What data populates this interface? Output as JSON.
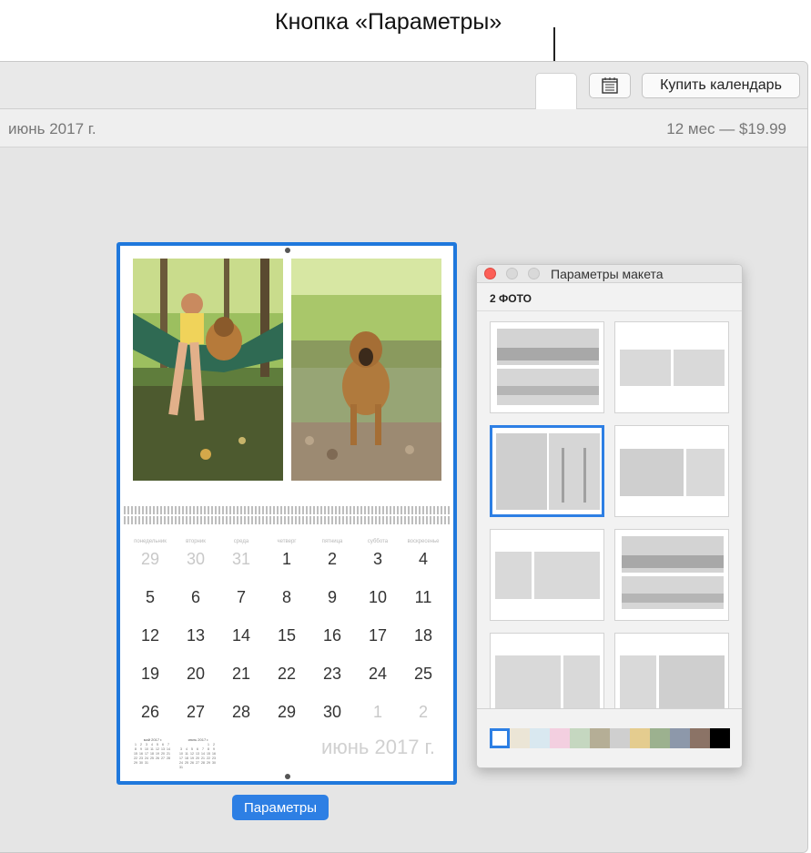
{
  "callout": {
    "label": "Кнопка «Параметры»"
  },
  "toolbar": {
    "layout_icon": "layout-panels-icon",
    "calendar_icon": "calendar-text-icon",
    "buy_label": "Купить календарь"
  },
  "infobar": {
    "month": "июнь 2017 г.",
    "price": "12 мес — $19.99"
  },
  "calendar_page": {
    "weekdays": [
      "понедельник",
      "вторник",
      "среда",
      "четверг",
      "пятница",
      "суббота",
      "воскресенье"
    ],
    "weeks": [
      [
        {
          "d": "29",
          "other": true
        },
        {
          "d": "30",
          "other": true
        },
        {
          "d": "31",
          "other": true
        },
        {
          "d": "1"
        },
        {
          "d": "2"
        },
        {
          "d": "3"
        },
        {
          "d": "4"
        }
      ],
      [
        {
          "d": "5"
        },
        {
          "d": "6"
        },
        {
          "d": "7"
        },
        {
          "d": "8"
        },
        {
          "d": "9"
        },
        {
          "d": "10"
        },
        {
          "d": "11"
        }
      ],
      [
        {
          "d": "12"
        },
        {
          "d": "13"
        },
        {
          "d": "14"
        },
        {
          "d": "15"
        },
        {
          "d": "16"
        },
        {
          "d": "17"
        },
        {
          "d": "18"
        }
      ],
      [
        {
          "d": "19"
        },
        {
          "d": "20"
        },
        {
          "d": "21"
        },
        {
          "d": "22"
        },
        {
          "d": "23"
        },
        {
          "d": "24"
        },
        {
          "d": "25"
        }
      ],
      [
        {
          "d": "26"
        },
        {
          "d": "27"
        },
        {
          "d": "28"
        },
        {
          "d": "29"
        },
        {
          "d": "30"
        },
        {
          "d": "1",
          "other": true
        },
        {
          "d": "2",
          "other": true
        }
      ]
    ],
    "month_label": "июнь 2017 г.",
    "mini_prev": "май 2017 г.",
    "mini_next": "июль 2017 г."
  },
  "params_button": {
    "label": "Параметры"
  },
  "panel": {
    "title": "Параметры макета",
    "section": "2 ФОТО",
    "selected_layout_index": 2,
    "swatches": [
      "#ffffff",
      "#ebe5d6",
      "#d9e8f0",
      "#f3cfe0",
      "#c5d7c0",
      "#b5ae96",
      "#cfcfcf",
      "#e4cc8f",
      "#9cb18f",
      "#8d98aa",
      "#8b7366",
      "#000000"
    ]
  },
  "accent": "#2d7fe4"
}
